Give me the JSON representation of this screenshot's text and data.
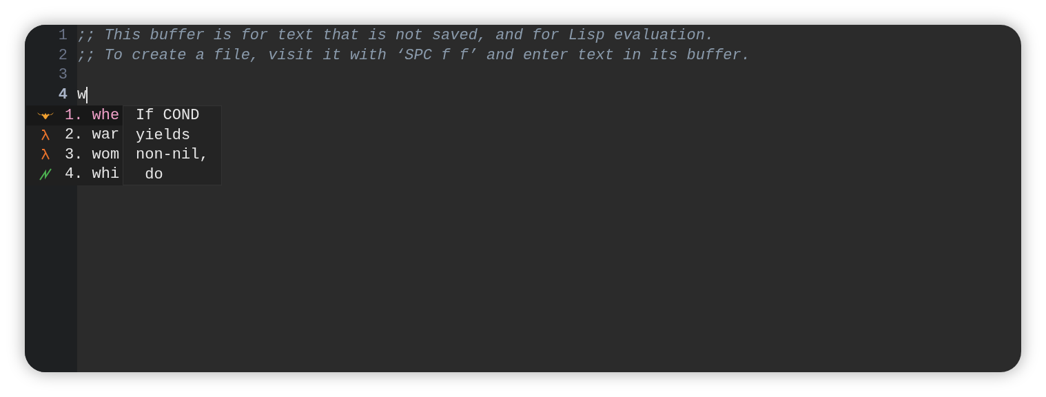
{
  "editor": {
    "lines": [
      {
        "number": "1",
        "text": ";; This buffer is for text that is not saved, and for Lisp evaluation.",
        "kind": "comment",
        "current": false
      },
      {
        "number": "2",
        "text": ";; To create a file, visit it with ‘SPC f f’ and enter text in its buffer.",
        "kind": "comment",
        "current": false
      },
      {
        "number": "3",
        "current": false
      },
      {
        "number": "4",
        "text": "w",
        "kind": "code",
        "current": true
      }
    ]
  },
  "completion": {
    "candidates": [
      {
        "kind": "snippet",
        "index": "1.",
        "label": "whe",
        "selected": true
      },
      {
        "kind": "function",
        "index": "2.",
        "label": "war",
        "selected": false
      },
      {
        "kind": "function",
        "index": "3.",
        "label": "wom",
        "selected": false
      },
      {
        "kind": "macro",
        "index": "4.",
        "label": "whi",
        "selected": false
      }
    ],
    "doc_lines": [
      "If COND",
      "yields",
      "non-nil,",
      " do"
    ]
  }
}
